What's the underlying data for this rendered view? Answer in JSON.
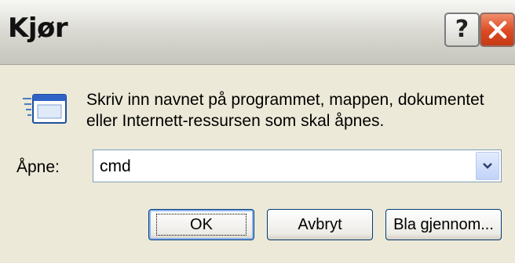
{
  "window": {
    "title": "Kjør"
  },
  "titlebar": {
    "help_label": "?",
    "close_label": "Close"
  },
  "message": "Skriv inn navnet på programmet, mappen, dokumentet eller Internett-ressursen som skal åpnes.",
  "open_field": {
    "label": "Åpne:",
    "value": "cmd"
  },
  "buttons": {
    "ok": "OK",
    "cancel": "Avbryt",
    "browse": "Bla gjennom..."
  },
  "colors": {
    "titlebar": "#d9d8d1",
    "close_button": "#e05a30",
    "dialog_body": "#ece9d8",
    "combo_border": "#7f9db9"
  },
  "icons": {
    "app": "run-icon",
    "dropdown": "chevron-down-icon",
    "help": "help-icon",
    "close": "close-icon"
  }
}
